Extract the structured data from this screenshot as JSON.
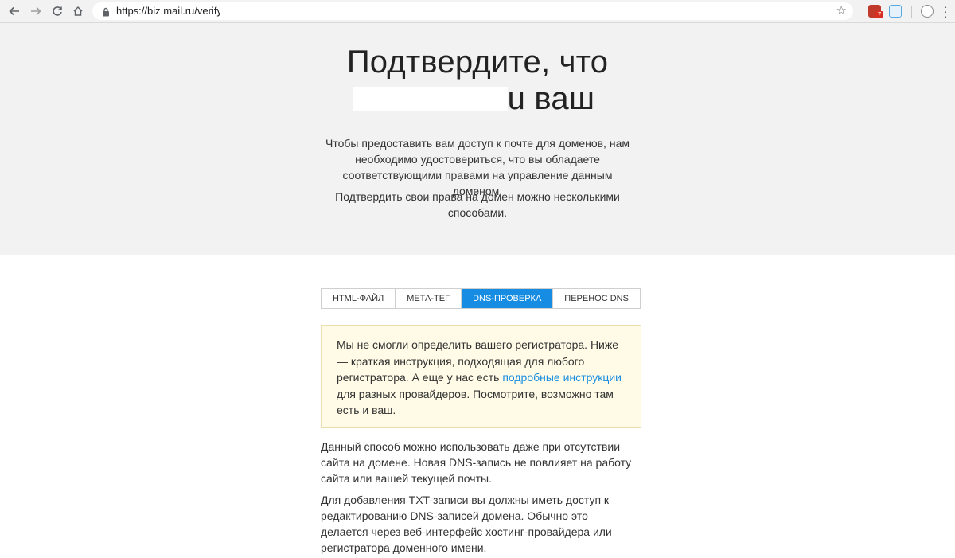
{
  "browser": {
    "url": "https://biz.mail.ru/verify",
    "extension_badge": "7"
  },
  "hero": {
    "title_line1": "Подтвердите, что",
    "title_line2": ".ru ваш",
    "para1": "Чтобы предоставить вам доступ к почте для доменов, нам необходимо удостовериться, что вы обладаете соответствующими правами на управление данным доменом.",
    "para2": "Подтвердить свои права на домен можно несколькими способами."
  },
  "tabs": [
    {
      "label": "HTML-ФАЙЛ",
      "active": false
    },
    {
      "label": "МЕТА-ТЕГ",
      "active": false
    },
    {
      "label": "DNS-ПРОВЕРКА",
      "active": true
    },
    {
      "label": "ПЕРЕНОС DNS",
      "active": false
    }
  ],
  "notice": {
    "text_before": "Мы не смогли определить вашего регистратора. Ниже — краткая инструкция, подходящая для любого регистратора. А еще у нас есть ",
    "link": "подробные инструкции",
    "text_after": " для разных провайдеров. Посмотрите, возможно там есть и ваш."
  },
  "content": {
    "para1": "Данный способ можно использовать даже при отсутствии сайта на домене. Новая DNS-запись не повлияет на работу сайта или вашей текущей почты.",
    "para2": "Для добавления TXT-записи вы должны иметь доступ к редактированию DNS-записей домена. Обычно это делается через веб-интерфейс хостинг-провайдера или регистратора доменного имени."
  },
  "colors": {
    "accent": "#168de2",
    "notice_bg": "#fffbe6",
    "hero_bg": "#f2f2f2"
  }
}
